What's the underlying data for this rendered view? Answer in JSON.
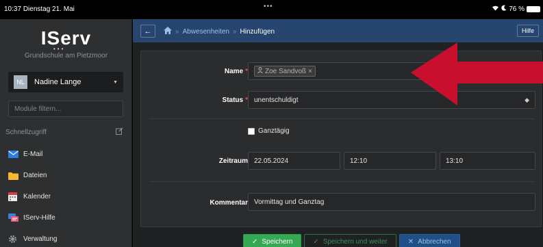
{
  "status_bar": {
    "time": "10:37",
    "date": "Dienstag 21. Mai",
    "dots": "•••",
    "battery": "76 %"
  },
  "sidebar": {
    "logo": "IServ",
    "school": "Grundschule am Pietzmoor",
    "user": {
      "initials": "NL",
      "name": "Nadine Lange"
    },
    "filter_placeholder": "Module filtern...",
    "quick_access_label": "Schnellzugriff",
    "items": [
      {
        "label": "E-Mail",
        "icon": "mail-icon",
        "color": "#2f7de1"
      },
      {
        "label": "Dateien",
        "icon": "folder-icon",
        "color": "#f5b82e"
      },
      {
        "label": "Kalender",
        "icon": "calendar-icon",
        "color": "#d93d3d"
      },
      {
        "label": "IServ-Hilfe",
        "icon": "help-chat-icon",
        "color": "#3d7fd9"
      },
      {
        "label": "Verwaltung",
        "icon": "gear-icon",
        "color": "#9aa0a6"
      }
    ]
  },
  "topbar": {
    "back": "←",
    "breadcrumb": [
      "Abwesenheiten",
      "Hinzufügen"
    ],
    "help": "Hilfe"
  },
  "form": {
    "name_label": "Name",
    "name_value": "Zoe Sandvoß",
    "status_label": "Status",
    "status_value": "unentschuldigt",
    "ganztaegig_label": "Ganztägig",
    "zeitraum_label": "Zeitraum",
    "date": "22.05.2024",
    "time_from": "12:10",
    "time_to": "13:10",
    "kommentar_label": "Kommentar",
    "kommentar_value": "Vormittag und Ganztag"
  },
  "buttons": {
    "save": "Speichern",
    "save_next": "Speichern und weiter",
    "cancel": "Abbrechen"
  },
  "colors": {
    "topbar": "#26466f",
    "annotation_arrow": "#c8102e",
    "save": "#34a853"
  }
}
